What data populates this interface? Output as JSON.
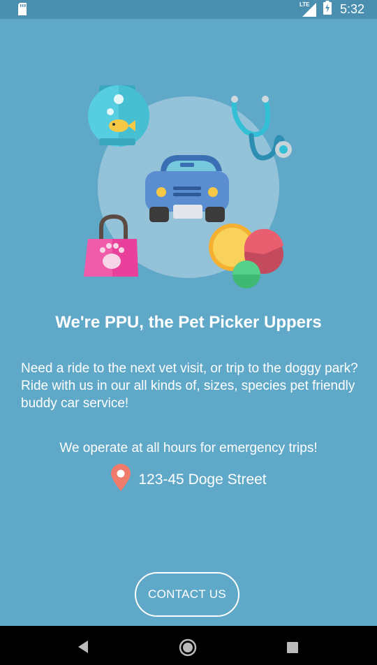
{
  "status_bar": {
    "network_label": "LTE",
    "time": "5:32",
    "icons": [
      "sd-card-icon",
      "signal-icon",
      "battery-charging-icon"
    ]
  },
  "hero": {
    "icons": [
      "fish-bowl-icon",
      "stethoscope-icon",
      "car-icon",
      "pet-bag-icon",
      "balls-icon"
    ]
  },
  "main": {
    "headline": "We're PPU, the Pet Picker Uppers",
    "description": "Need a ride to the next vet visit, or trip to the doggy park? Ride with us in our all kinds of, sizes, species pet friendly buddy car service!",
    "hours": "We operate at all hours for emergency trips!",
    "address": "123-45 Doge Street",
    "contact_label": "CONTACT US"
  },
  "nav_bar": {
    "icons": [
      "back-icon",
      "home-icon",
      "recents-icon"
    ]
  },
  "colors": {
    "background": "#5fa8c8",
    "status_bar": "#4a8fb0",
    "accent_pin": "#f07a6c"
  }
}
